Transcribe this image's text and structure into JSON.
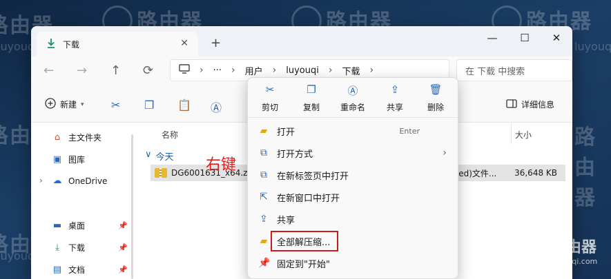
{
  "watermark": {
    "brand_text": "路由器",
    "domain_text": "luyouqi.com"
  },
  "window": {
    "tab_title": "下载",
    "new_tab": "+",
    "controls": {
      "minimize": "—",
      "maximize": "☐",
      "close": "✕"
    }
  },
  "nav": {
    "back": "←",
    "forward": "→",
    "up": "↑",
    "refresh": "⟳",
    "breadcrumb": [
      "用户",
      "luyouqi",
      "下载"
    ],
    "more": "···",
    "search_placeholder": "在 下载 中搜索"
  },
  "toolbar": {
    "new_label": "新建",
    "details_label": "详细信息"
  },
  "sidebar": {
    "items": [
      {
        "label": "主文件夹",
        "icon": "home-icon"
      },
      {
        "label": "图库",
        "icon": "gallery-icon"
      },
      {
        "label": "OneDrive",
        "icon": "cloud-icon"
      },
      {
        "label": "桌面",
        "icon": "desktop-icon"
      },
      {
        "label": "下载",
        "icon": "download-icon"
      },
      {
        "label": "文档",
        "icon": "document-icon"
      }
    ]
  },
  "content": {
    "col_name": "名称",
    "col_size": "大小",
    "group": "今天",
    "file": {
      "name": "DG6001631_x64.zip",
      "type": "pped)文件...",
      "size": "36,648 KB"
    }
  },
  "annotation": "右键",
  "context_menu": {
    "actions": [
      {
        "label": "剪切",
        "icon": "cut-icon"
      },
      {
        "label": "复制",
        "icon": "copy-icon"
      },
      {
        "label": "重命名",
        "icon": "rename-icon"
      },
      {
        "label": "共享",
        "icon": "share-icon"
      },
      {
        "label": "删除",
        "icon": "delete-icon"
      }
    ],
    "items": [
      {
        "label": "打开",
        "shortcut": "Enter"
      },
      {
        "label": "打开方式"
      },
      {
        "label": "在新标签页中打开"
      },
      {
        "label": "在新窗口中打开"
      },
      {
        "label": "共享"
      },
      {
        "label": "全部解压缩..."
      },
      {
        "label": "固定到\"开始\""
      }
    ]
  },
  "colors": {
    "accent": "#2b67b3",
    "highlight_box": "#d21a1a",
    "annotation": "#e02020"
  }
}
